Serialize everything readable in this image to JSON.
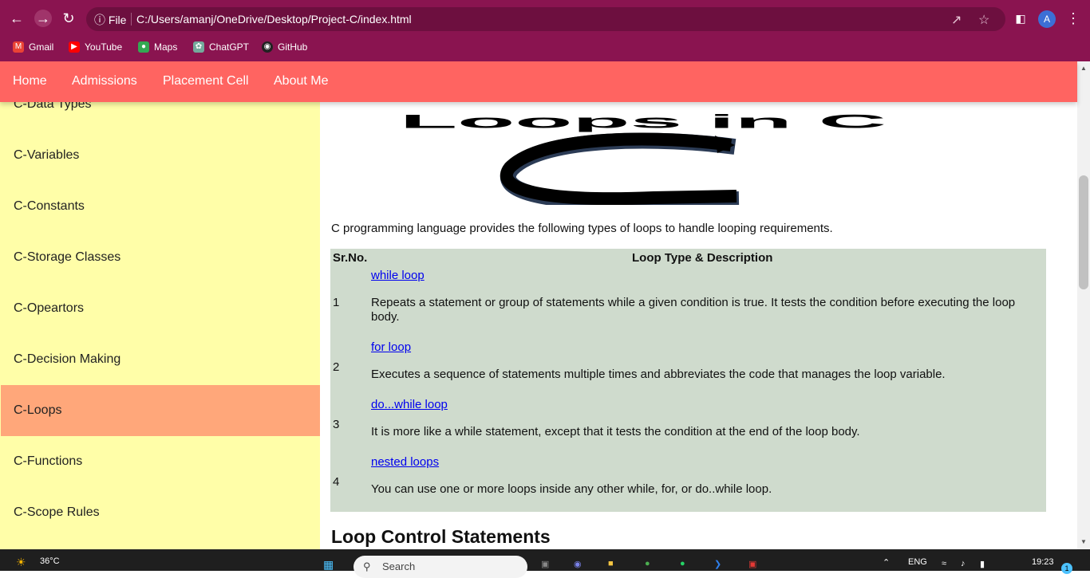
{
  "browser": {
    "url_scheme": "File",
    "url": "C:/Users/amanj/OneDrive/Desktop/Project-C/index.html",
    "profile_initial": "A",
    "bookmarks": [
      {
        "label": "Gmail",
        "icon": "gmail-icon",
        "color": "#ea4335"
      },
      {
        "label": "YouTube",
        "icon": "youtube-icon",
        "color": "#ff0000"
      },
      {
        "label": "Maps",
        "icon": "maps-icon",
        "color": "#34a853"
      },
      {
        "label": "ChatGPT",
        "icon": "chatgpt-icon",
        "color": "#74aa9c"
      },
      {
        "label": "GitHub",
        "icon": "github-icon",
        "color": "#222222"
      }
    ]
  },
  "topnav": {
    "items": [
      "Home",
      "Admissions",
      "Placement Cell",
      "About Me"
    ]
  },
  "sidebar": {
    "items": [
      "C-Data Types",
      "C-Variables",
      "C-Constants",
      "C-Storage Classes",
      "C-Opeartors",
      "C-Decision Making",
      "C-Loops",
      "C-Functions",
      "C-Scope Rules"
    ],
    "active": "C-Loops"
  },
  "content": {
    "banner_title": "Loops in C",
    "banner_letter": "C",
    "intro": "C programming language provides the following types of loops to handle looping requirements.",
    "table": {
      "headers": [
        "Sr.No.",
        "Loop Type & Description"
      ],
      "rows": [
        {
          "num": "1",
          "link": "while loop",
          "desc": "Repeats a statement or group of statements while a given condition is true. It tests the condition before executing the loop body."
        },
        {
          "num": "2",
          "link": "for loop",
          "desc": "Executes a sequence of statements multiple times and abbreviates the code that manages the loop variable."
        },
        {
          "num": "3",
          "link": "do...while loop",
          "desc": "It is more like a while statement, except that it tests the condition at the end of the loop body."
        },
        {
          "num": "4",
          "link": "nested loops",
          "desc": "You can use one or more loops inside any other while, for, or do..while loop."
        }
      ]
    },
    "section_heading": "Loop Control Statements"
  },
  "colors": {
    "browser_frame": "#8a1450",
    "topnav": "#ff6461",
    "sidebar": "#fffea8",
    "sidebar_active": "#ffa77a",
    "table_bg": "#cfdbcd"
  },
  "taskbar": {
    "weather": "36°C",
    "search_placeholder": "Search",
    "language": "ENG",
    "time": "19:23",
    "notification_count": "1"
  }
}
